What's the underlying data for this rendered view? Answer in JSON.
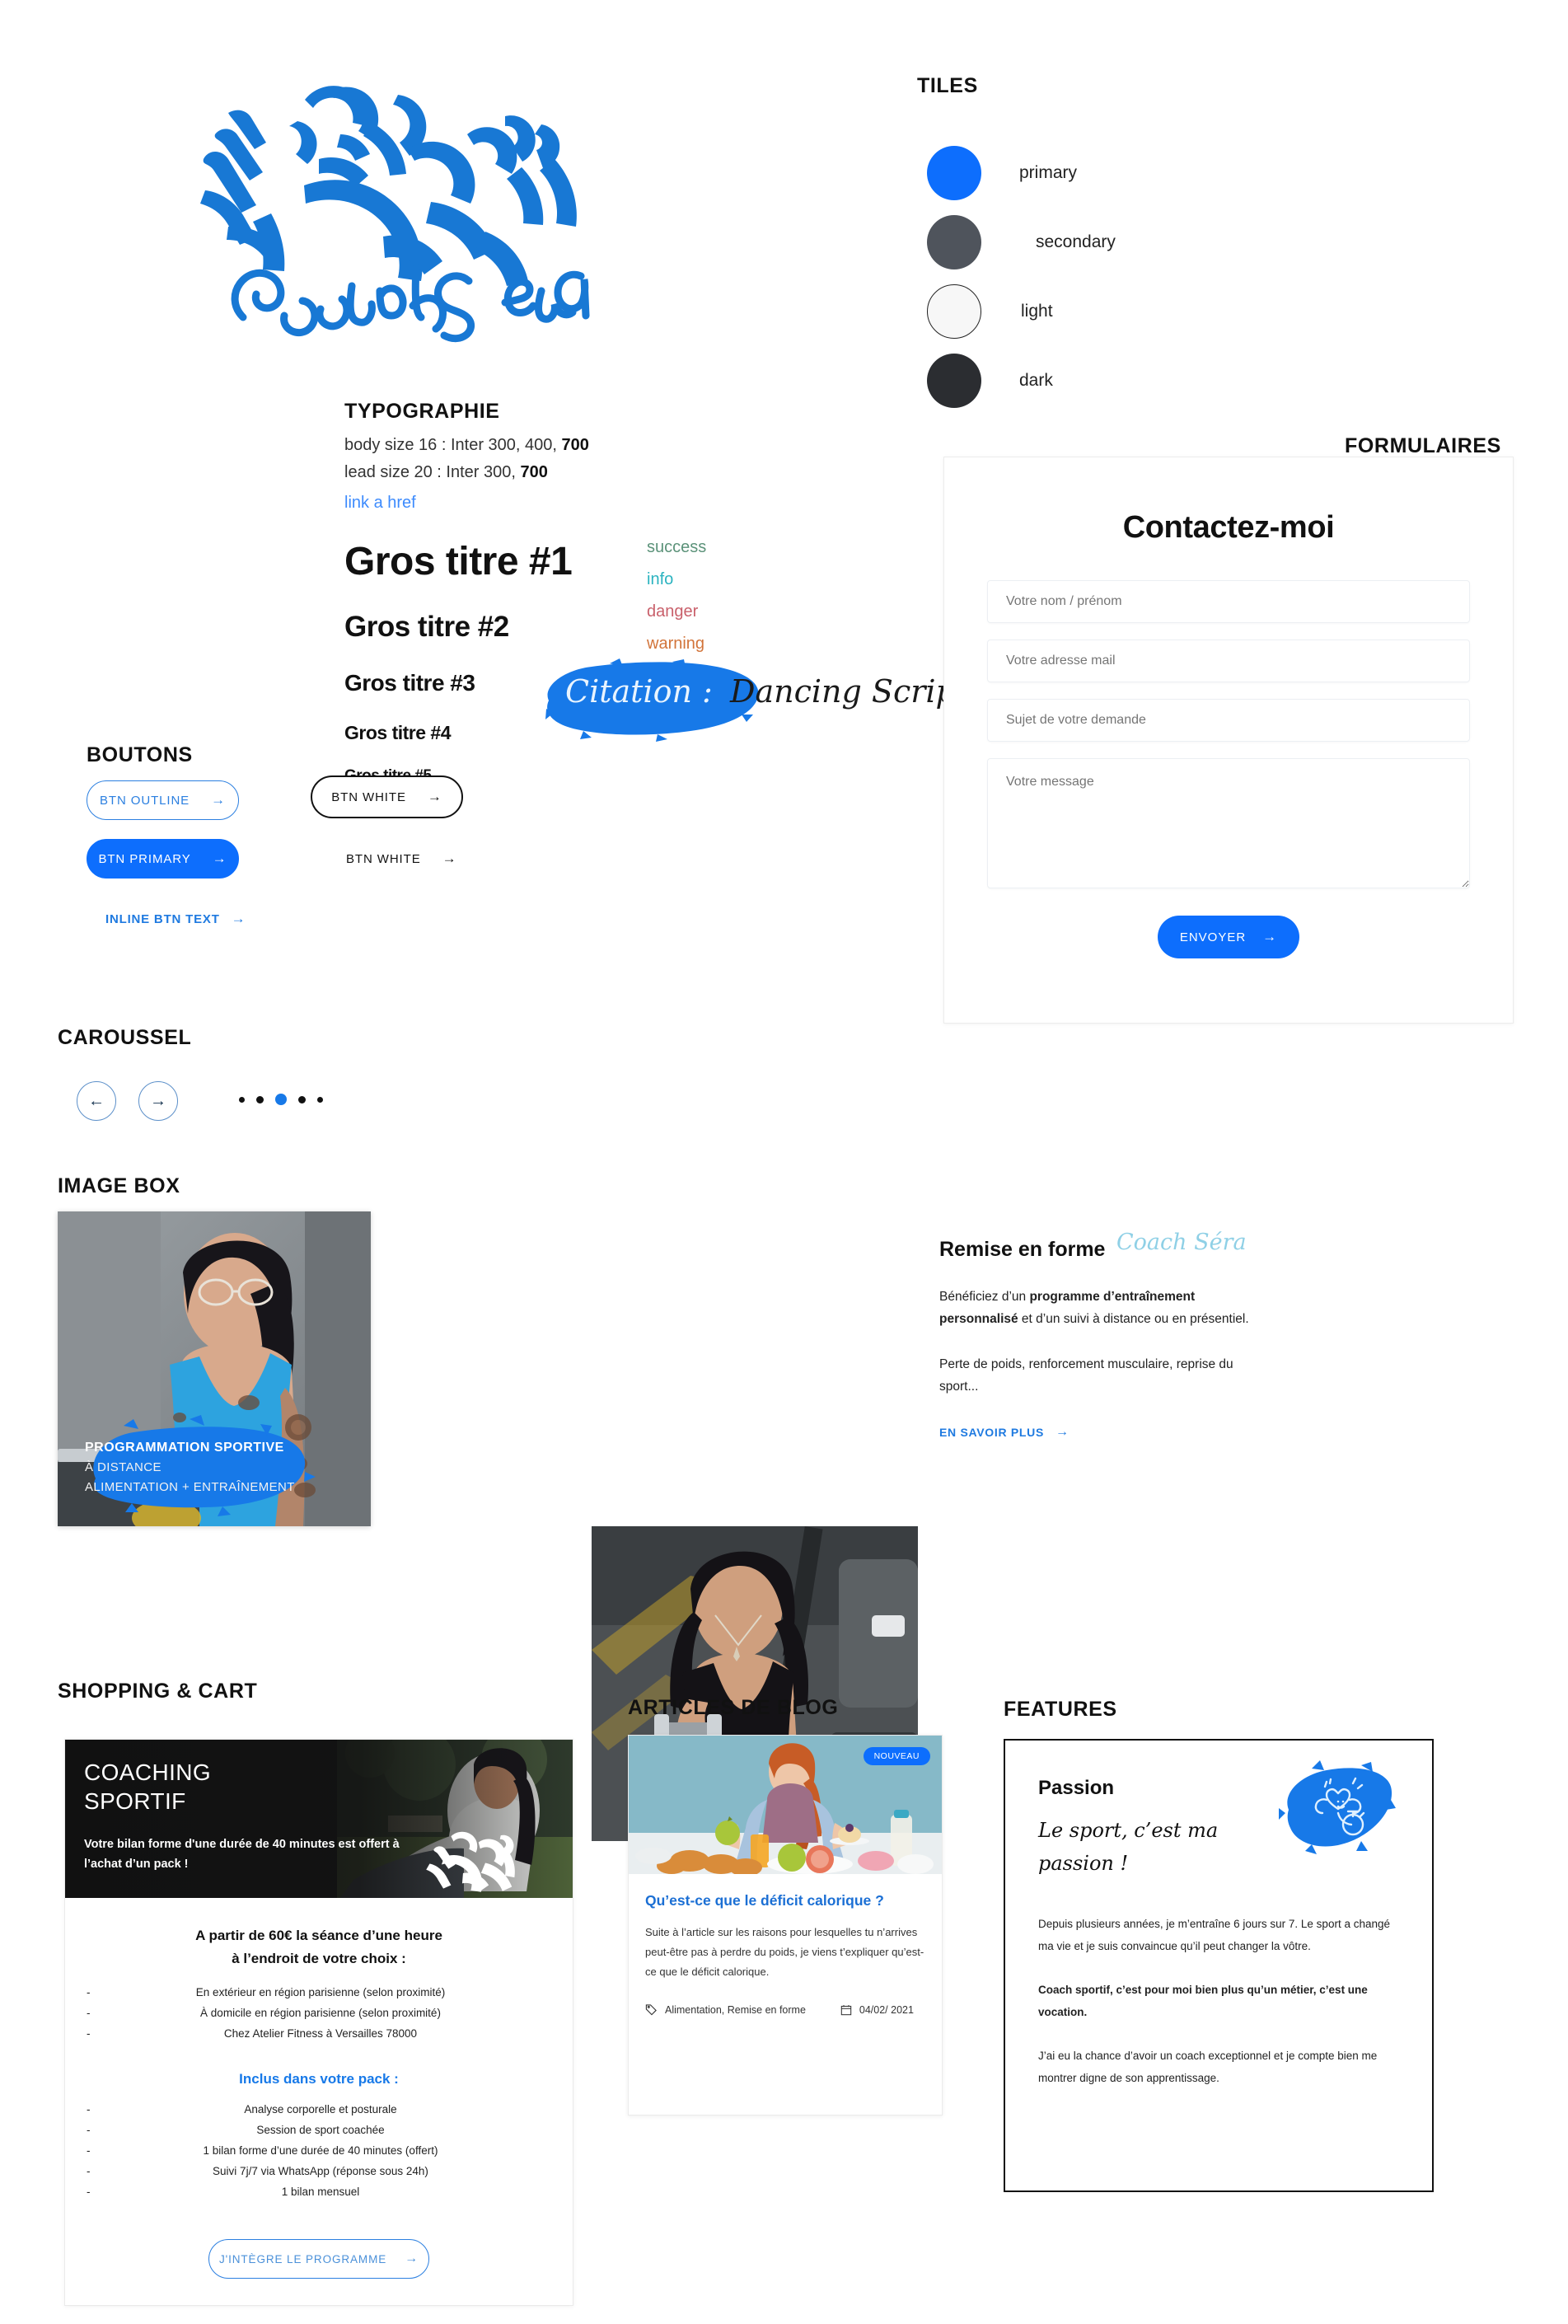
{
  "logo": {
    "brand_script": "Coach Sera",
    "alt": "coach-sera-logo"
  },
  "tiles": {
    "title": "TILES",
    "items": [
      {
        "label": "primary",
        "color": "#0d6efd"
      },
      {
        "label": "secondary",
        "color": "#4f545c"
      },
      {
        "label": "light",
        "color": "#f7f7f7"
      },
      {
        "label": "dark",
        "color": "#2b2d31"
      }
    ]
  },
  "typography": {
    "title": "TYPOGRAPHIE",
    "body_line_prefix": "body size 16 : Inter 300, 400, ",
    "body_line_bold": "700",
    "lead_line_prefix": "lead size 20 : Inter 300, ",
    "lead_line_bold": "700",
    "link_text": "link a href",
    "headings": [
      "Gros titre #1",
      "Gros titre #2",
      "Gros titre #3",
      "Gros titre #4",
      "Gros titre #5"
    ],
    "semantic": [
      {
        "label": "success",
        "color": "#5b9279"
      },
      {
        "label": "info",
        "color": "#2bb3c0"
      },
      {
        "label": "danger",
        "color": "#c9606b"
      },
      {
        "label": "warning",
        "color": "#d2743a"
      }
    ],
    "citation_white": "Citation : ",
    "citation_dark": "Dancing Script"
  },
  "buttons": {
    "title": "BOUTONS",
    "outline": "BTN OUTLINE",
    "primary": "BTN PRIMARY",
    "white_bordered": "BTN WHITE",
    "white_plain": "BTN WHITE",
    "inline": "INLINE BTN TEXT",
    "arrow": "→"
  },
  "form": {
    "section_title": "FORMULAIRES",
    "heading": "Contactez-moi",
    "name_placeholder": "Votre nom / prénom",
    "email_placeholder": "Votre adresse mail",
    "subject_placeholder": "Sujet de votre demande",
    "message_placeholder": "Votre message",
    "submit_label": "ENVOYER",
    "arrow": "→"
  },
  "carousel": {
    "title": "CAROUSSEL",
    "prev_arrow": "←",
    "next_arrow": "→",
    "dot_count": 5,
    "active_dot_index": 2
  },
  "image_box": {
    "title": "IMAGE BOX",
    "left_caption": {
      "line1": "PROGRAMMATION SPORTIVE",
      "line2": "À DISTANCE",
      "line3": "ALIMENTATION + ENTRAÎNEMENT"
    },
    "right": {
      "title": "Remise en forme",
      "script": "Coach Séra",
      "p1_a": "Bénéficiez d’un ",
      "p1_bold": "programme d’entraînement personnalisé",
      "p1_b": " et d’un suivi à distance ou en présentiel.",
      "p2": "Perte de poids, renforcement musculaire, reprise du sport...",
      "link": "EN SAVOIR PLUS",
      "arrow": "→"
    }
  },
  "shopping": {
    "title": "SHOPPING & CART",
    "hero_title_l1": "COACHING",
    "hero_title_l2": "SPORTIF",
    "hero_sub": "Votre bilan forme d'une durée de 40 minutes est offert à l’achat d’un pack !",
    "lead_l1": "A partir de 60€ la séance d’une heure",
    "lead_l2": "à l’endroit de votre choix :",
    "places": [
      "En extérieur en région parisienne (selon proximité)",
      "À domicile en région parisienne (selon proximité)",
      "Chez Atelier Fitness à Versailles 78000"
    ],
    "pack_title": "Inclus dans votre pack :",
    "pack_items": [
      "Analyse corporelle et posturale",
      "Session de sport coachée",
      "1 bilan forme d’une durée de 40 minutes (offert)",
      "Suivi 7j/7 via WhatsApp (réponse sous 24h)",
      "1 bilan mensuel"
    ],
    "dash": "-",
    "cta": "J'INTÈGRE LE PROGRAMME",
    "arrow": "→"
  },
  "blog": {
    "title": "ARTICLES DE BLOG",
    "badge": "NOUVEAU",
    "article_title": "Qu’est-ce que le déficit calorique ?",
    "excerpt": "Suite à l’article sur les raisons pour lesquelles tu n’arrives peut-être pas à perdre du poids, je viens t’expliquer qu’est-ce que le déficit calorique.",
    "tags": "Alimentation, Remise en forme",
    "date": "04/02/ 2021"
  },
  "features": {
    "title": "FEATURES",
    "heading": "Passion",
    "script": "Le sport, c’est ma passion !",
    "p1": "Depuis plusieurs années, je m’entraîne 6 jours sur 7. Le sport a changé ma vie et je suis convaincue qu’il peut changer la vôtre.",
    "p2": "Coach sportif, c’est pour moi bien plus qu’un métier, c’est une vocation.",
    "p3": "J’ai eu la chance d’avoir un coach exceptionnel et je compte bien me montrer digne de son apprentissage."
  }
}
